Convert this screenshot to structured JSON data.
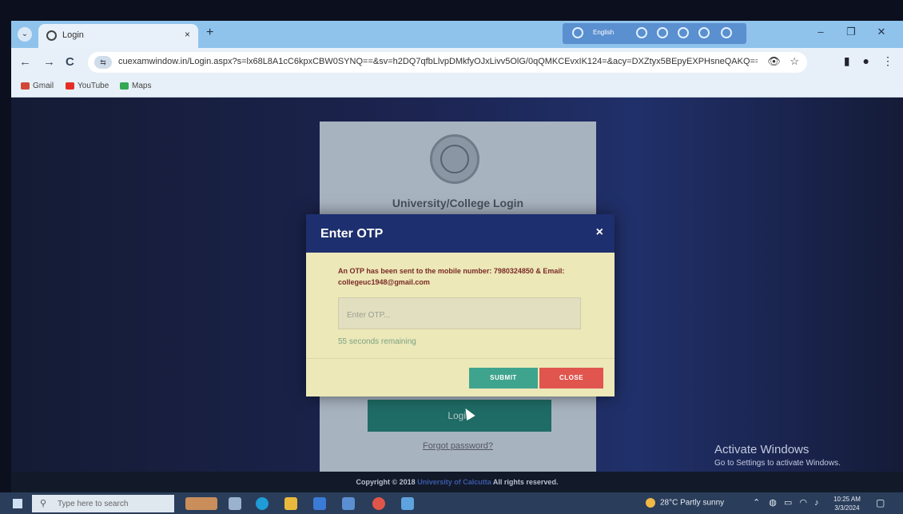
{
  "browser": {
    "tab_title": "Login",
    "tab_close": "×",
    "new_tab": "+",
    "language": "English",
    "minimize": "–",
    "restore": "❐",
    "close": "✕",
    "url": "cuexamwindow.in/Login.aspx?s=lx68L8A1cC6kpxCBW0SYNQ==&sv=h2DQ7qfbLlvpDMkfyOJxLivv5OlG/0qQMKCEvxIK124=&acy=DXZtyx5BEpyEXPHsneQAKQ==&...",
    "back": "←",
    "forward": "→",
    "reload": "C"
  },
  "bookmarks": [
    {
      "label": "Gmail",
      "color": "#d14836"
    },
    {
      "label": "YouTube",
      "color": "#e52d27"
    },
    {
      "label": "Maps",
      "color": "#34a853"
    }
  ],
  "login_card": {
    "title": "University/College Login",
    "login_button": "Login",
    "forgot_link": "Forgot password?"
  },
  "modal": {
    "title": "Enter OTP",
    "close_x": "×",
    "message": "An OTP has been sent to the mobile number: 7980324850 & Email: collegeuc1948@gmail.com",
    "otp_placeholder": "Enter OTP...",
    "timer": "55 seconds remaining",
    "submit": "SUBMIT",
    "close": "CLOSE"
  },
  "watermark": {
    "title": "Activate Windows",
    "subtitle": "Go to Settings to activate Windows."
  },
  "footer": {
    "prefix": "Copyright © 2018",
    "university": "University of Calcutta",
    "suffix": "All rights reserved."
  },
  "taskbar": {
    "search_placeholder": "Type here to search",
    "weather": "28°C  Partly sunny",
    "time": "10:25 AM",
    "date": "3/3/2024"
  },
  "colors": {
    "modal_header": "#1d2f6e",
    "submit": "#3fa48d",
    "close": "#e0564f",
    "login_button": "#1f6b66"
  }
}
